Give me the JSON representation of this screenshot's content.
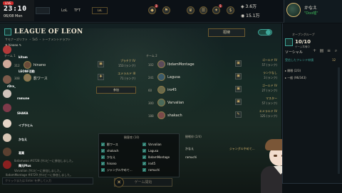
{
  "topbar": {
    "live": "LIVE",
    "clock": "23:10",
    "date": "06/08 Mon",
    "nav": [
      "LoL",
      "TFT"
    ],
    "mode_label": "LoL",
    "notif_counts": [
      "3",
      "5"
    ],
    "currency_rp": "3.6万",
    "currency_be": "15.1万",
    "profile_name": "かなえ",
    "profile_status": "\"Doo嘘\""
  },
  "lobby": {
    "title": "LEAGUE OF LEON",
    "subtitle": "サモナーズリフト ・ 5v5 ・ トーナメントドラフト",
    "owner": "hinano",
    "invite_label": "招待",
    "team1_label": "チーム 1",
    "team2_label": "チーム 2",
    "join_label": "参加",
    "team1": [
      {
        "level": "312",
        "name": "hinano",
        "rank1": "プラチナ IV",
        "rank2": "153 (ランク)"
      },
      {
        "level": "308",
        "name": "影ワース",
        "rank1": "エメラルド III",
        "rank2": "71 (ランク)"
      }
    ],
    "team2": [
      {
        "level": "102",
        "name": "IbdamMontage",
        "rank1": "ゴールド IV",
        "rank2": "57 (ランク)"
      },
      {
        "level": "241",
        "name": "Lagusa",
        "rank1": "ランクなし",
        "rank2": "3 (ランク)"
      },
      {
        "level": "60",
        "name": "iro45",
        "rank1": "ゴールド IV",
        "rank2": "27 (ランク)"
      },
      {
        "level": "300",
        "name": "Varvalian",
        "rank1": "マスター",
        "rank2": "57 (ランク)"
      },
      {
        "level": "188",
        "name": "shakach",
        "rank1": "エメラルド IV",
        "rank2": "125 (ランク)"
      }
    ]
  },
  "left_chat": {
    "names": [
      "kitam",
      "LEONF活動",
      "rDra_",
      "ramune",
      "SHAKA",
      "イブラヒム",
      "かなえ",
      "葛葉",
      "舞元Plus"
    ],
    "lines": [
      "Ibdamwoo #0728 がロビーに参加しました。",
      "Varvalian がロビーに参加しました。",
      "IbdamMontage #0729 がロビーに参加しました。"
    ],
    "chat_placeholder": "クリックまたは Enter を押して入力"
  },
  "spectators": {
    "title": "観客席 (10)",
    "col1": [
      "影ワース",
      "shakach",
      "かなえ",
      "hinano",
      "ジャングルやめて..."
    ],
    "col2": [
      "Varvalian",
      "Lagusa",
      "IbdamMontage",
      "iro45",
      "ramuchi"
    ]
  },
  "start_label": "ゲーム開始",
  "waiting": {
    "title": "観戦枠 (2/4)",
    "p1": "かなえ",
    "p1_role": "ジャングルやめて...",
    "p2": "ramuchi"
  },
  "social": {
    "open_group_title": "オープングループ",
    "count": "10/10",
    "count_sub": "ゲーム準備中",
    "header": "ソーシャル",
    "requests_label": "受信したフレンド申請",
    "requests_count": "12",
    "groups": [
      "開眼 (2/3)",
      "一般 (96/343)"
    ]
  },
  "colors": {
    "accent": "#3fa79a",
    "gold": "#d7b56d",
    "bg": "#0b0f12"
  }
}
